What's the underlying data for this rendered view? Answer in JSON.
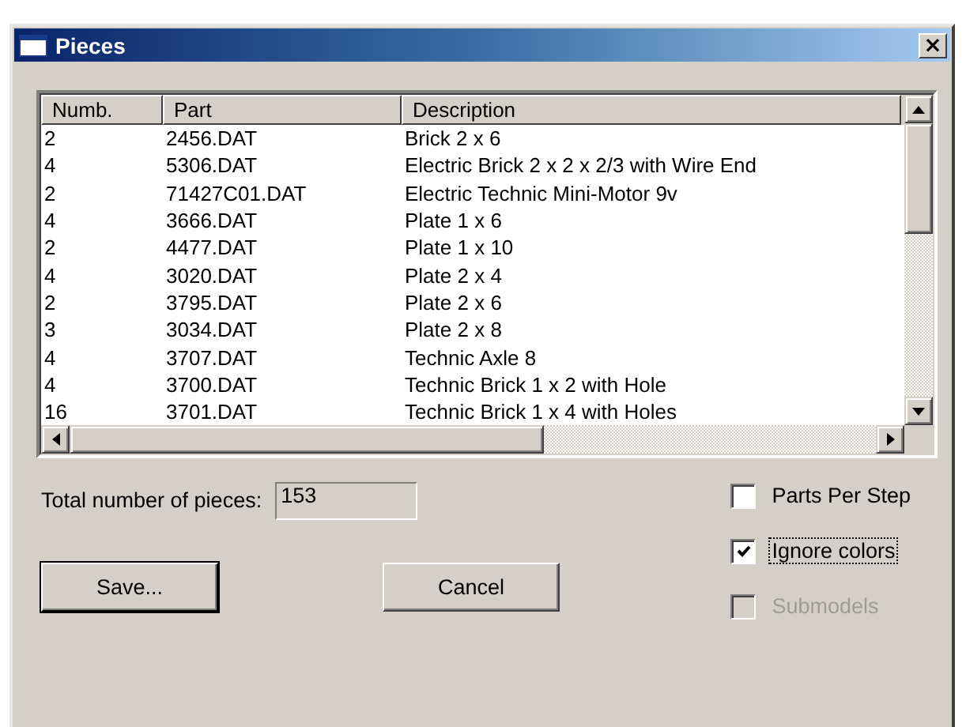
{
  "window": {
    "title": "Pieces",
    "close": "×"
  },
  "table": {
    "columns": [
      "Numb.",
      "Part",
      "Description"
    ],
    "rows": [
      {
        "cells": [
          "2",
          "2456.DAT",
          "Brick  2 x  6"
        ]
      },
      {
        "cells": [
          "4",
          "5306.DAT",
          "Electric Brick  2 x  2 x  2/3 with Wire End"
        ]
      },
      {
        "cells": [
          "2",
          "71427C01.DAT",
          "Electric Technic Mini-Motor  9v"
        ]
      },
      {
        "cells": [
          "4",
          "3666.DAT",
          "Plate  1 x  6"
        ]
      },
      {
        "cells": [
          "2",
          "4477.DAT",
          "Plate  1 x 10"
        ]
      },
      {
        "cells": [
          "4",
          "3020.DAT",
          "Plate  2 x  4"
        ]
      },
      {
        "cells": [
          "2",
          "3795.DAT",
          "Plate  2 x  6"
        ]
      },
      {
        "cells": [
          "3",
          "3034.DAT",
          "Plate  2 x  8"
        ]
      },
      {
        "cells": [
          "4",
          "3707.DAT",
          "Technic Axle  8"
        ]
      },
      {
        "cells": [
          "4",
          "3700.DAT",
          "Technic Brick  1 x  2 with Hole"
        ]
      },
      {
        "cells": [
          "16",
          "3701.DAT",
          "Technic Brick  1 x  4 with Holes"
        ]
      }
    ]
  },
  "total": {
    "label": "Total number of pieces:",
    "value": "153"
  },
  "options": [
    {
      "label": "Parts Per Step",
      "checked": false,
      "disabled": false,
      "focused": false
    },
    {
      "label": "Ignore colors",
      "checked": true,
      "disabled": false,
      "focused": true
    },
    {
      "label": "Submodels",
      "checked": false,
      "disabled": true,
      "focused": false
    }
  ],
  "buttons": [
    {
      "label": "Save...",
      "default": true
    },
    {
      "label": "Cancel",
      "default": false
    }
  ]
}
